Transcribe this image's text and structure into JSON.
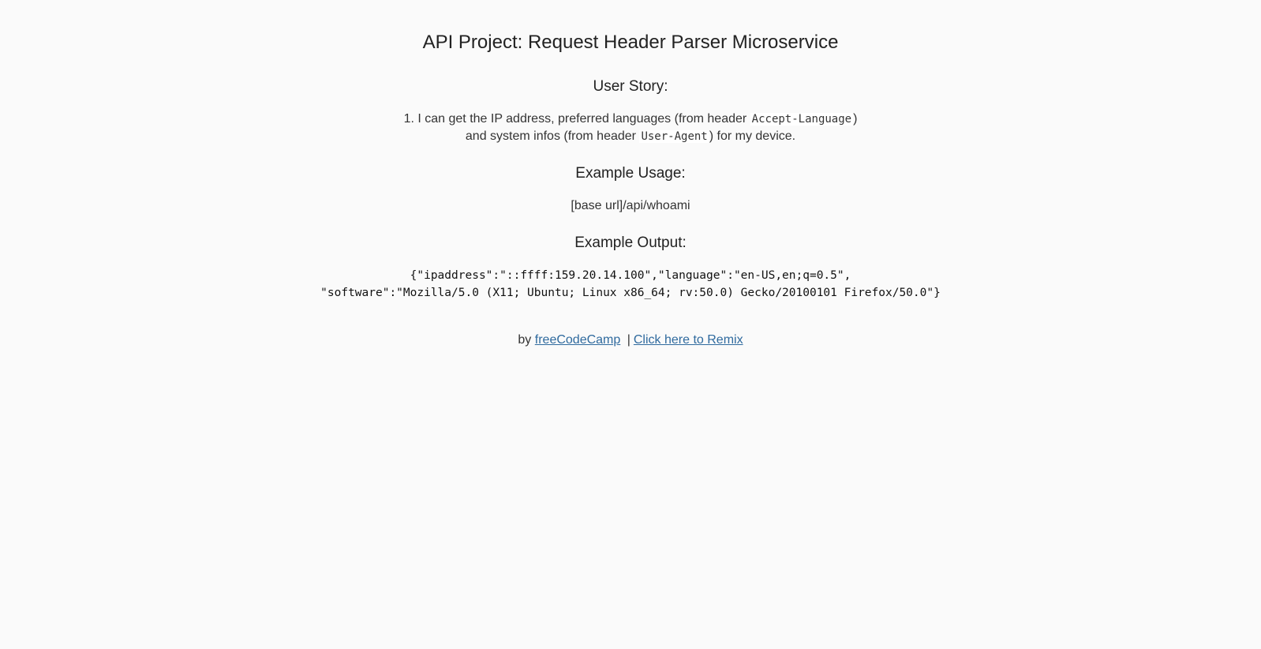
{
  "header": {
    "title": "API Project: Request Header Parser Microservice"
  },
  "user_story": {
    "heading": "User Story:",
    "item_prefix": "1. I can get the IP address, preferred languages (from header ",
    "code_accept_language": "Accept-Language",
    "item_mid_close": ")",
    "item_line2_prefix": "and system infos (from header ",
    "code_user_agent": "User-Agent",
    "item_line2_suffix": ") for my device."
  },
  "example_usage": {
    "heading": "Example Usage:",
    "url": "[base url]/api/whoami"
  },
  "example_output": {
    "heading": "Example Output:",
    "line1": "{\"ipaddress\":\"::ffff:159.20.14.100\",\"language\":\"en-US,en;q=0.5\",",
    "line2": "\"software\":\"Mozilla/5.0 (X11; Ubuntu; Linux x86_64; rv:50.0) Gecko/20100101 Firefox/50.0\"}"
  },
  "footer": {
    "by_label": "by",
    "fcc_link": "freeCodeCamp",
    "separator": "|",
    "remix_link": "Click here to Remix"
  },
  "colors": {
    "background": "#fafafa",
    "link": "#2f6a9e"
  }
}
